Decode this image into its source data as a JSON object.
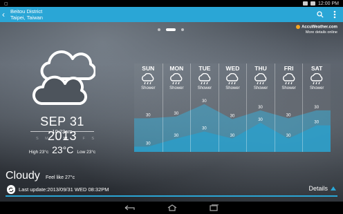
{
  "status": {
    "time": "12:00 PM"
  },
  "header": {
    "location_line1": "Beitou District",
    "location_line2": "Taipei, Taiwan",
    "accent": "#2aa6d6"
  },
  "branding": {
    "name": "AccuWeather.com",
    "tagline": "More details online"
  },
  "current": {
    "date": "SEP 31 2013",
    "time": "10:23am",
    "weekdays": [
      "S",
      "M",
      "T",
      "W",
      "T",
      "F",
      "S"
    ],
    "current_weekday_index": 3,
    "high": "High 23°c",
    "now": "23°C",
    "low": "Low 23°c",
    "condition": "Cloudy",
    "feels_like": "Feel like 27°c",
    "last_update": "Last update:2013/09/31 WED 08:32PM",
    "details_label": "Details"
  },
  "forecast": {
    "days": [
      {
        "name": "SUN",
        "condition": "Shower",
        "high": "30",
        "low": "30"
      },
      {
        "name": "MON",
        "condition": "Shower",
        "high": "30",
        "low": "30"
      },
      {
        "name": "TUE",
        "condition": "Shower",
        "high": "30",
        "low": "30"
      },
      {
        "name": "WED",
        "condition": "Shower",
        "high": "30",
        "low": "30"
      },
      {
        "name": "THU",
        "condition": "Shower",
        "high": "30",
        "low": "30"
      },
      {
        "name": "FRI",
        "condition": "Shower",
        "high": "30",
        "low": "30"
      },
      {
        "name": "SAT",
        "condition": "Shower",
        "high": "30",
        "low": "30"
      }
    ],
    "high_levels": [
      0.62,
      0.6,
      0.46,
      0.63,
      0.53,
      0.62,
      0.53
    ],
    "low_levels": [
      0.94,
      0.85,
      0.77,
      0.85,
      0.67,
      0.85,
      0.7
    ]
  }
}
